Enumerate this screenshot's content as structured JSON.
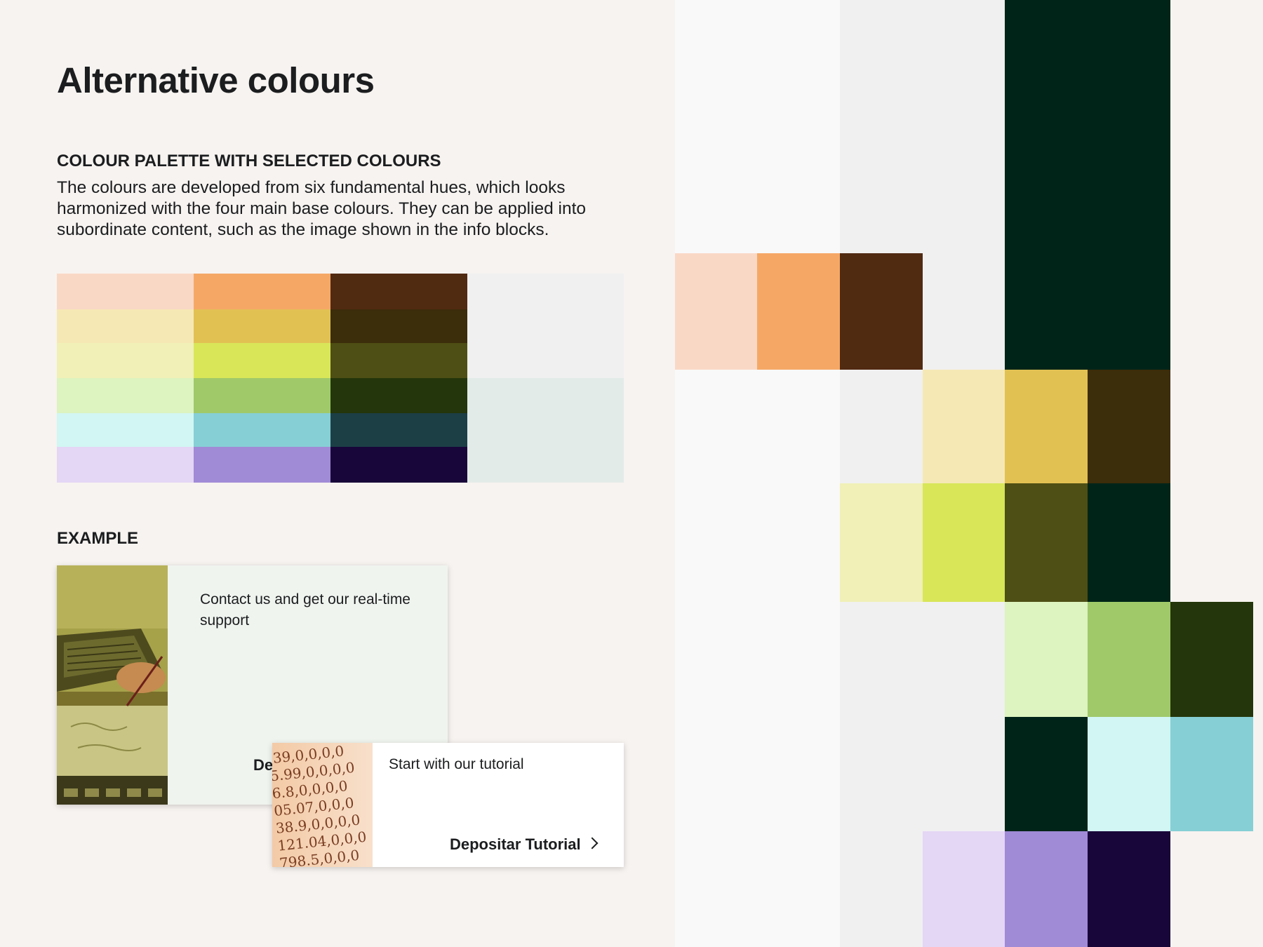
{
  "page": {
    "title": "Alternative colours"
  },
  "palette_section": {
    "heading": "COLOUR PALETTE WITH SELECTED COLOURS",
    "description": "The colours are developed from six fundamental hues, which looks harmonized with the four main base colours. They can be applied into subordinate content, such as the image shown in the info blocks."
  },
  "palette": {
    "rows": [
      [
        "#f9d8c6",
        "#f5a866",
        "#512a12"
      ],
      [
        "#f6e8b5",
        "#e2c153",
        "#3c2d0b"
      ],
      [
        "#f0f0b7",
        "#d8e658",
        "#4e4f14"
      ],
      [
        "#ddf3c0",
        "#a0c96a",
        "#24360b"
      ],
      [
        "#d1f6f3",
        "#86cfd5",
        "#1c3f46"
      ],
      [
        "#e4d6f5",
        "#a08bd6",
        "#180539"
      ]
    ],
    "base": [
      "#f0f0f0",
      "#e3ebe8"
    ]
  },
  "example_section": {
    "heading": "EXAMPLE"
  },
  "cards": [
    {
      "text": "Contact us and get our real-time support",
      "link": "De",
      "background": "#f0f4ef",
      "image": "laptop-photo"
    },
    {
      "text": "Start with our tutorial",
      "link": "Depositar Tutorial",
      "background": "#ffffff",
      "image": "numbers-photo",
      "numbers": [
        ".39,0,0,0,0",
        "5.99,0,0,0,0",
        "6.8,0,0,0,0",
        "05.07,0,0,0",
        "38.9,0,0,0,0",
        "121.04,0,0,0",
        "798.5,0,0,0"
      ]
    }
  ],
  "colors": {
    "background": "#f7f3f0",
    "text": "#1b1d1f",
    "right_columns": [
      "#f9f9f9",
      "#f0f0f0",
      "#002418",
      "#1b1d1f"
    ]
  },
  "icons": [
    "chevron-right-icon"
  ]
}
